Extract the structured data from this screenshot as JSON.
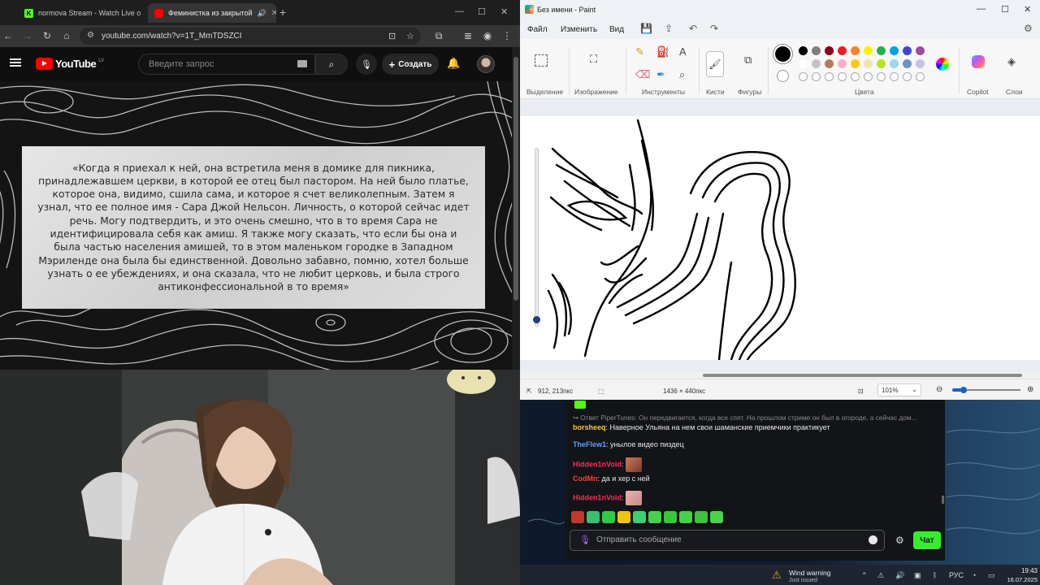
{
  "browser": {
    "tabs": [
      {
        "title": "normova Stream - Watch Live o",
        "favicon_color": "#53fc18",
        "favicon_letter": "K"
      },
      {
        "title": "Феминистка из закрытой",
        "favicon_color": "#ff0000",
        "favicon_letter": ""
      }
    ],
    "url": "youtube.com/watch?v=1T_MmTDSZCI"
  },
  "youtube": {
    "logo_text": "YouTube",
    "region": "LV",
    "search_placeholder": "Введите запрос",
    "create_label": "Создать"
  },
  "video": {
    "quote": "«Когда я приехал к ней, она встретила меня в домике для пикника, принадлежавшем церкви, в которой ее отец был пастором. На ней было платье, которое она, видимо, сшила сама, и которое я счет великолепным. Затем я узнал, что ее полное имя - Сара Джой Нельсон. Личность, о которой сейчас идет речь. Могу подтвердить, и это очень смешно, что в то время Сара не идентифицировала себя как амиш. Я также могу сказать, что если бы она и была частью населения амишей, то в этом маленьком городке в Западном Мэриленде она была бы единственной. Довольно забавно, помню, хотел больше узнать о ее убеждениях, и она сказала, что не любит церковь, и была строго антиконфессиональной в то время»"
  },
  "paint": {
    "title": "Без имени - Paint",
    "menu": [
      "Файл",
      "Изменить",
      "Вид"
    ],
    "groups": [
      "Выделение",
      "Изображение",
      "Инструменты",
      "Кисти",
      "Фигуры",
      "Цвета",
      "Copilot",
      "Слои"
    ],
    "palette_row1": [
      "#000000",
      "#7f7f7f",
      "#880015",
      "#ed1c24",
      "#ff7f27",
      "#fff200",
      "#22b14c",
      "#00a2e8",
      "#3f48cc",
      "#a349a4"
    ],
    "palette_row2": [
      "#ffffff",
      "#c3c3c3",
      "#b97a57",
      "#ffaec9",
      "#ffc90e",
      "#efe4b0",
      "#b5e61d",
      "#99d9ea",
      "#7092be",
      "#c8bfe7"
    ],
    "status": {
      "cursor": "912, 213пкс",
      "size": "1436 × 440пкс",
      "zoom": "101%"
    }
  },
  "chat": {
    "reply": "Ответ PiperTunes: Он передвигается, когда все спят. На прошлом стриме он был в огороде, а сейчас дом...",
    "messages": [
      {
        "user": "borsheeq",
        "color": "#f2c94c",
        "text": "Наверное Ульяна на нем свои шаманские приемчики практикует"
      },
      {
        "user": "TheFlew1",
        "color": "#5aa0ff",
        "text": "унылое видео пиздец"
      },
      {
        "user": "Hidden1nVoid",
        "color": "#ff2d55",
        "text": ""
      },
      {
        "user": "CodMn",
        "color": "#ff3b3b",
        "text": "да и хер с ней"
      },
      {
        "user": "Hidden1nVoid",
        "color": "#ff2d55",
        "text": ""
      }
    ],
    "input_placeholder": "Отправить сообщение",
    "send_label": "Чат"
  },
  "taskbar": {
    "notification_title": "Wind warning",
    "notification_sub": "Just issued",
    "lang": "РУС",
    "time": "19:43",
    "date": "16.07.2025"
  }
}
